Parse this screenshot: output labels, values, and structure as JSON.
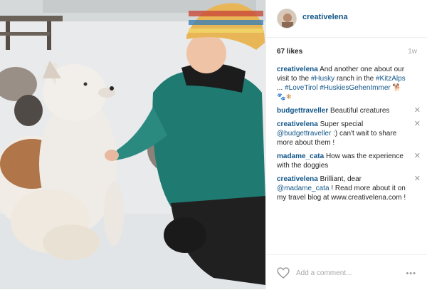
{
  "post": {
    "username": "creativelena",
    "likes": "67 likes",
    "age": "1w",
    "caption": {
      "author": "creativelena",
      "text1": "And another one about our visit to the",
      "tag1": "#Husky",
      "text2": "ranch in the",
      "tag2": "#KitzAlps",
      "text3": "...",
      "tag3": "#LoveTirol",
      "tag4": "#HuskiesGehenImmer",
      "emoji": "🐕🐾❄"
    },
    "comments": [
      {
        "author": "budgettraveller",
        "text": "Beautiful creatures"
      },
      {
        "author": "creativelena",
        "text1": "Super special",
        "mention": "@budgettraveller",
        "text2": ":) can't wait to share more about them !"
      },
      {
        "author": "madame_cata",
        "text": "How was the experience with the doggies"
      },
      {
        "author": "creativelena",
        "text1": "Brilliant, dear",
        "mention": "@madame_cata",
        "text2": "! Read more about it on my travel blog at www.creativelena.com !"
      }
    ],
    "add_comment_placeholder": "Add a comment...",
    "more_label": "•••",
    "delete_label": "✕"
  }
}
